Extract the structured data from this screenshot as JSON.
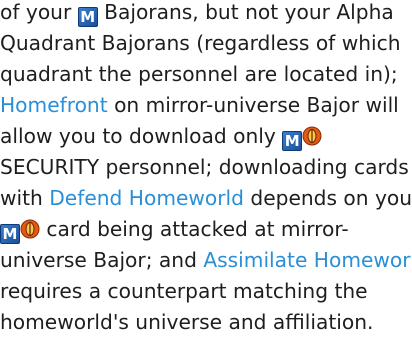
{
  "doc": {
    "l1": {
      "pre": "of your",
      "post": "Bajorans, but not your Alpha"
    },
    "l2": "Quadrant Bajorans (regardless of which",
    "l3": "quadrant the personnel are located in);",
    "l4": {
      "link": "Homefront",
      "post": "on mirror-universe Bajor will"
    },
    "l5": "allow you to download only",
    "l6": "SECURITY personnel; downloading cards",
    "l7": {
      "pre": "with",
      "link": "Defend Homeworld",
      "post": "depends on your"
    },
    "l8": "card being attacked at mirror-",
    "l9": {
      "pre": "universe Bajor; and",
      "link": "Assimilate Homeworld"
    },
    "l10": "requires a counterpart matching the",
    "l11": "homeworld's universe and affiliation."
  },
  "icons": {
    "mirror": {
      "name": "mirror-universe-icon",
      "letter": "M",
      "color": "#2a62b8"
    },
    "security": {
      "name": "security-icon",
      "color": "#e05a16"
    }
  },
  "colors": {
    "text": "#1e1e1e",
    "link": "#2a8fd6"
  }
}
